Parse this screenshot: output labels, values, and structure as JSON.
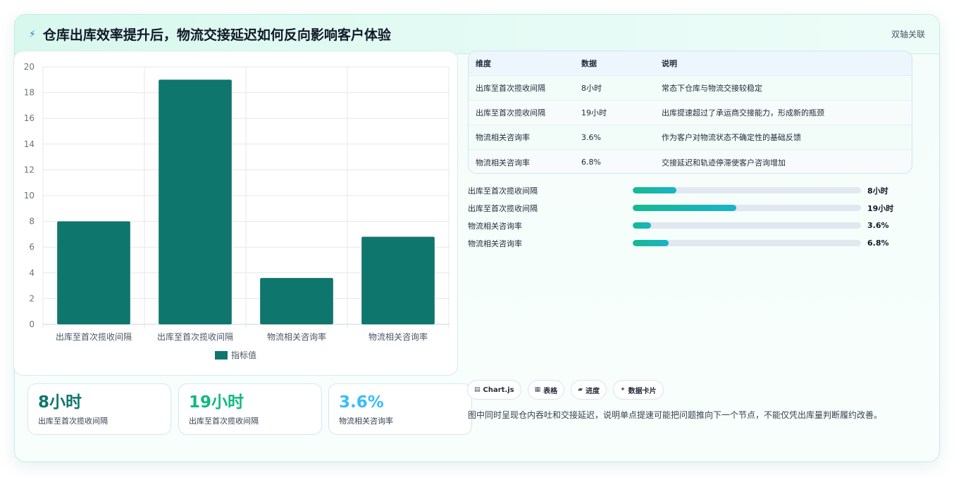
{
  "header": {
    "title": "仓库出库效率提升后，物流交接延迟如何反向影响客户体验",
    "tag": "双轴关联"
  },
  "chart_data": {
    "type": "bar",
    "categories": [
      "出库至首次揽收间隔",
      "出库至首次揽收间隔",
      "物流相关咨询率",
      "物流相关咨询率"
    ],
    "series": [
      {
        "name": "指标值",
        "values": [
          8,
          19,
          3.6,
          6.8
        ]
      }
    ],
    "ylim": [
      0,
      20
    ],
    "yticks": [
      0,
      2,
      4,
      6,
      8,
      10,
      12,
      14,
      16,
      18,
      20
    ],
    "legend_position": "bottom",
    "grid": true,
    "bar_color": "#0f766e"
  },
  "kpis": [
    {
      "value": "8小时",
      "label": "出库至首次揽收间隔",
      "color": "#0f766e"
    },
    {
      "value": "19小时",
      "label": "出库至首次揽收间隔",
      "color": "#10b981"
    },
    {
      "value": "3.6%",
      "label": "物流相关咨询率",
      "color": "#38bdf8"
    }
  ],
  "table": {
    "headers": [
      "维度",
      "数据",
      "说明"
    ],
    "rows": [
      [
        "出库至首次揽收间隔",
        "8小时",
        "常态下仓库与物流交接较稳定"
      ],
      [
        "出库至首次揽收间隔",
        "19小时",
        "出库提速超过了承运商交接能力，形成新的瓶颈"
      ],
      [
        "物流相关咨询率",
        "3.6%",
        "作为客户对物流状态不确定性的基础反馈"
      ],
      [
        "物流相关咨询率",
        "6.8%",
        "交接延迟和轨迹停滞使客户咨询增加"
      ]
    ]
  },
  "progress": [
    {
      "label": "出库至首次揽收间隔",
      "value": "8小时",
      "fraction": 0.19
    },
    {
      "label": "出库至首次揽收间隔",
      "value": "19小时",
      "fraction": 0.455
    },
    {
      "label": "物流相关咨询率",
      "value": "3.6%",
      "fraction": 0.08
    },
    {
      "label": "物流相关咨询率",
      "value": "6.8%",
      "fraction": 0.157
    }
  ],
  "chips": [
    {
      "icon": "chart-icon",
      "glyph": "▤",
      "label": "Chart.js"
    },
    {
      "icon": "table-icon",
      "glyph": "▦",
      "label": "表格"
    },
    {
      "icon": "progress-icon",
      "glyph": "▰",
      "label": "进度"
    },
    {
      "icon": "sparkle-icon",
      "glyph": "✦",
      "label": "数据卡片"
    }
  ],
  "note": "图中同时呈现仓内吞吐和交接延迟，说明单点提速可能把问题推向下一个节点，不能仅凭出库量判断履约改善。"
}
